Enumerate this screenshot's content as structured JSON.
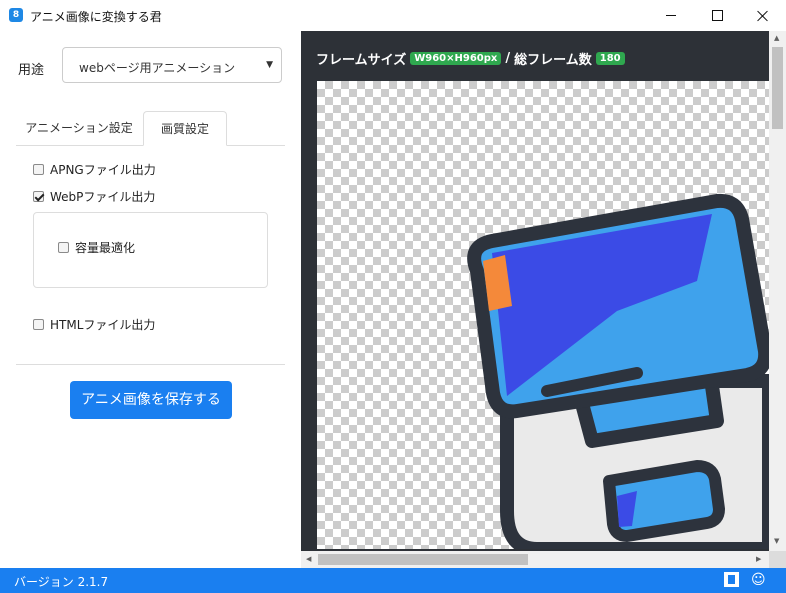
{
  "window": {
    "title": "アニメ画像に変換する君",
    "app_icon_text": "8"
  },
  "left_panel": {
    "purpose_label": "用途",
    "purpose_value": "webページ用アニメーション",
    "tabs": [
      {
        "label": "アニメーション設定",
        "active": false
      },
      {
        "label": "画質設定",
        "active": true
      }
    ],
    "options": {
      "apng": {
        "label": "APNGファイル出力",
        "checked": false
      },
      "webp": {
        "label": "WebPファイル出力",
        "checked": true
      },
      "optimize": {
        "label": "容量最適化",
        "checked": false
      },
      "html": {
        "label": "HTMLファイル出力",
        "checked": false
      }
    },
    "save_button": "アニメ画像を保存する"
  },
  "preview": {
    "frame_size_label": "フレームサイズ",
    "frame_size_value": "W960×H960px",
    "separator": "/",
    "total_frames_label": "総フレーム数",
    "total_frames_value": "180"
  },
  "status_bar": {
    "version": "バージョン 2.1.7"
  },
  "colors": {
    "accent": "#1a7ff0",
    "badge_green": "#2fa84f",
    "preview_bg": "#2d3137"
  }
}
